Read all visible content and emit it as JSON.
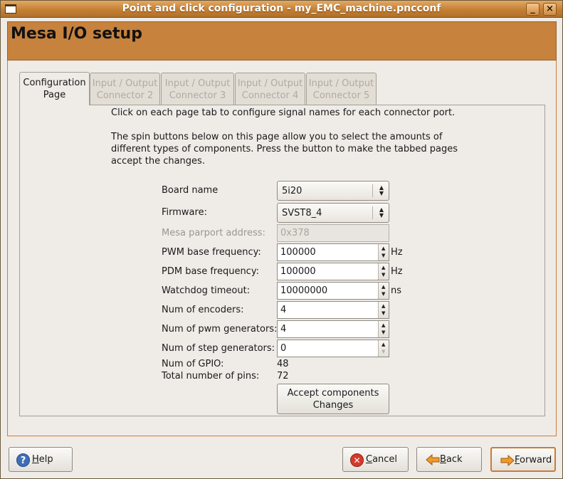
{
  "window": {
    "title": "Point and click configuration - my_EMC_machine.pncconf",
    "minimize_glyph": "_",
    "close_glyph": "×"
  },
  "header": {
    "title": "Mesa I/O setup"
  },
  "tabs": [
    {
      "line1": "Configuration",
      "line2": "Page",
      "active": true
    },
    {
      "line1": "Input / Output",
      "line2": "Connector 2",
      "active": false
    },
    {
      "line1": "Input / Output",
      "line2": "Connector 3",
      "active": false
    },
    {
      "line1": "Input / Output",
      "line2": "Connector 4",
      "active": false
    },
    {
      "line1": "Input / Output",
      "line2": "Connector 5",
      "active": false
    }
  ],
  "intro": {
    "p1": "Click on each page tab to configure signal names for each connector port.",
    "p2": "The spin buttons below on this page allow you to select the amounts of different types of components. Press the button to make the tabbed pages accept the changes."
  },
  "form": {
    "board_name": {
      "label": "Board name",
      "value": "5i20"
    },
    "firmware": {
      "label": "Firmware:",
      "value": "SVST8_4"
    },
    "parport": {
      "label": "Mesa parport address:",
      "value": "0x378"
    },
    "pwm_freq": {
      "label": "PWM base frequency:",
      "value": "100000",
      "unit": "Hz"
    },
    "pdm_freq": {
      "label": "PDM base frequency:",
      "value": "100000",
      "unit": "Hz"
    },
    "watchdog": {
      "label": "Watchdog timeout:",
      "value": "10000000",
      "unit": "ns"
    },
    "encoders": {
      "label": "Num of encoders:",
      "value": "4"
    },
    "pwm_gens": {
      "label": "Num of pwm generators:",
      "value": "4"
    },
    "step_gens": {
      "label": "Num of step generators:",
      "value": "0"
    },
    "gpio": {
      "label": "Num of GPIO:",
      "value": "48"
    },
    "total_pins": {
      "label": "Total number of pins:",
      "value": "72"
    },
    "accept": {
      "line1": "Accept  components",
      "line2": "Changes"
    }
  },
  "buttons": {
    "help": {
      "mnemonic": "H",
      "rest": "elp",
      "icon": "help-icon"
    },
    "cancel": {
      "mnemonic": "C",
      "rest": "ancel",
      "icon": "cancel-icon"
    },
    "back": {
      "mnemonic": "B",
      "rest": "ack",
      "icon": "back-arrow-icon"
    },
    "forward": {
      "mnemonic": "F",
      "rest": "orward",
      "icon": "forward-arrow-icon"
    }
  },
  "colors": {
    "accent": "#c7823d",
    "titlebar": "#c47f34"
  }
}
